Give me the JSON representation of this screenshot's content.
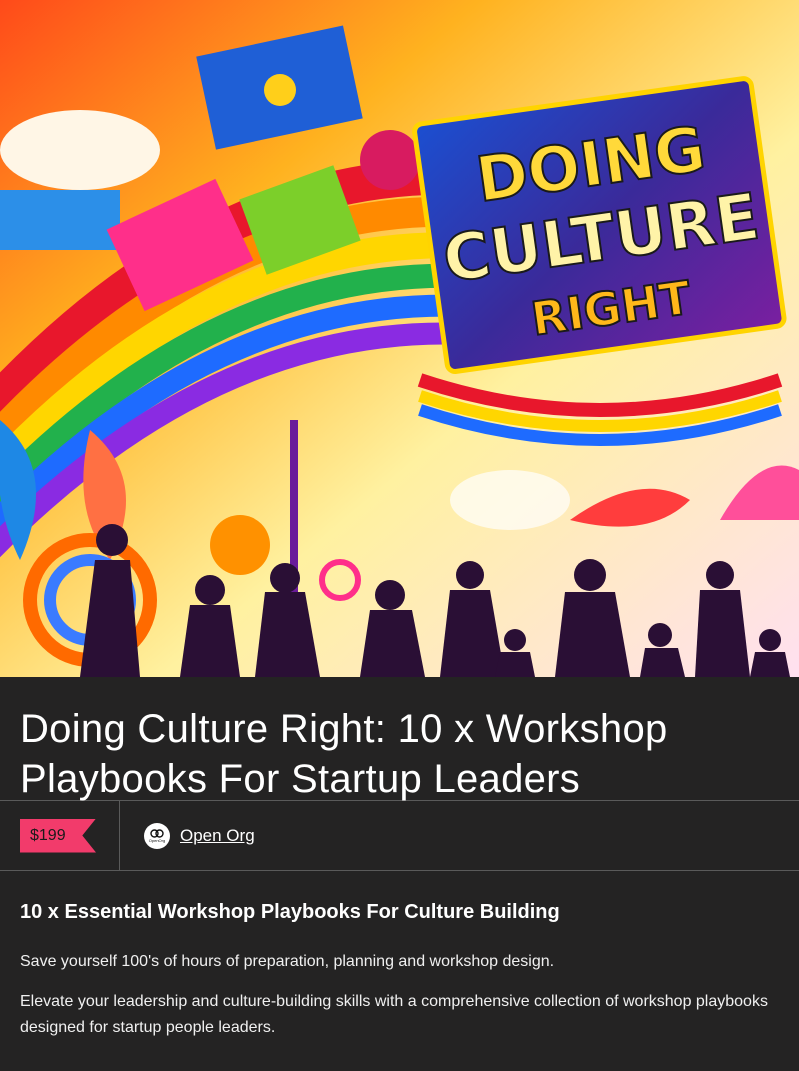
{
  "hero": {
    "image_alt": "Colorful illustration with sign reading Doing Culture Right",
    "sign_line1": "DOING",
    "sign_line2": "CULTURE",
    "sign_line3": "RIGHT"
  },
  "product": {
    "title": "Doing Culture Right: 10 x Workshop Playbooks For Startup Leaders",
    "price": "$199",
    "seller_name": "Open Org",
    "seller_avatar_text": "OpenOrg"
  },
  "description": {
    "heading": "10 x Essential Workshop Playbooks For Culture Building",
    "paragraphs": [
      "Save yourself 100's of hours of preparation, planning and workshop design.",
      "Elevate your leadership and culture-building skills with a comprehensive collection of workshop playbooks designed for startup people leaders."
    ]
  },
  "colors": {
    "background": "#242323",
    "price_tag": "#f23b6b",
    "divider": "#5a5a5a"
  }
}
